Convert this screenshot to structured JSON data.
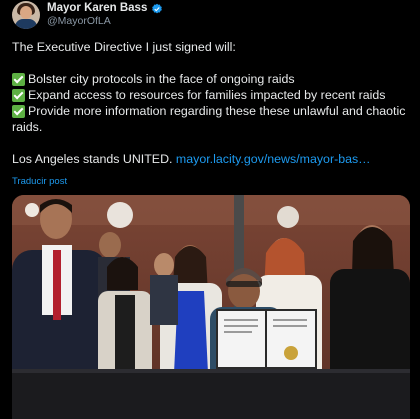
{
  "author": {
    "display_name": "Mayor Karen Bass",
    "handle": "@MayorOfLA",
    "verified_icon": "verified-badge-icon",
    "badge_color": "#1d9bf0"
  },
  "post": {
    "intro": "The Executive Directive I just signed will:",
    "items": [
      "Bolster city protocols in the face of ongoing raids",
      "Expand access to resources for families impacted by recent raids",
      "Provide more information regarding these these unlawful and chaotic"
    ],
    "item_continuation": "raids.",
    "closing": "Los Angeles stands UNITED.",
    "link_text": "mayor.lacity.gov/news/mayor-bas…",
    "translate_label": "Traducir post"
  },
  "media": {
    "kind": "photo"
  }
}
